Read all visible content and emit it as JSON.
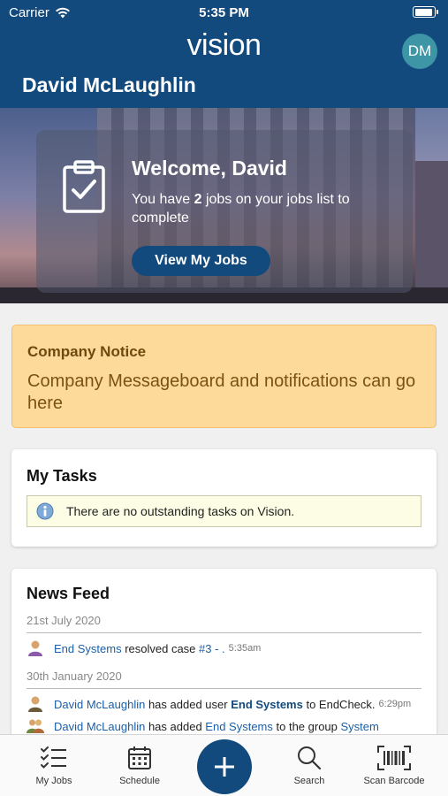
{
  "status_bar": {
    "carrier": "Carrier",
    "time": "5:35 PM"
  },
  "header": {
    "app_name": "vision",
    "avatar_initials": "DM",
    "user_name": "David McLaughlin"
  },
  "welcome": {
    "title": "Welcome, David",
    "message_prefix": "You have ",
    "job_count": "2",
    "message_suffix": " jobs on your jobs list to complete",
    "button_label": "View My Jobs"
  },
  "notice": {
    "title": "Company Notice",
    "body": "Company Messageboard and notifications can go here"
  },
  "tasks": {
    "title": "My Tasks",
    "empty_message": "There are no outstanding tasks on Vision."
  },
  "news_feed": {
    "title": "News Feed",
    "groups": [
      {
        "date": "21st July 2020",
        "entries": [
          {
            "actor": "End Systems",
            "text_1": " resolved case ",
            "link": "#3 - .",
            "text_2": "",
            "time": "5:35am"
          }
        ]
      },
      {
        "date": "30th January 2020",
        "entries": [
          {
            "actor": "David McLaughlin",
            "text_1": " has added user ",
            "link": "End Systems",
            "text_2": " to EndCheck.",
            "time": "6:29pm"
          },
          {
            "actor": "David McLaughlin",
            "text_1": " has added ",
            "link": "End Systems",
            "text_2": " to the group ",
            "link_2": "System"
          }
        ]
      }
    ]
  },
  "tab_bar": {
    "items": [
      {
        "label": "My Jobs",
        "icon": "checklist-icon"
      },
      {
        "label": "Schedule",
        "icon": "calendar-icon"
      },
      {
        "label": "",
        "icon": "plus-icon"
      },
      {
        "label": "Search",
        "icon": "search-icon"
      },
      {
        "label": "Scan Barcode",
        "icon": "barcode-icon"
      }
    ]
  },
  "colors": {
    "brand_blue": "#124a7e",
    "avatar_teal": "#3d95a6",
    "notice_bg": "#fdd99a",
    "link_blue": "#1a5fa8"
  }
}
